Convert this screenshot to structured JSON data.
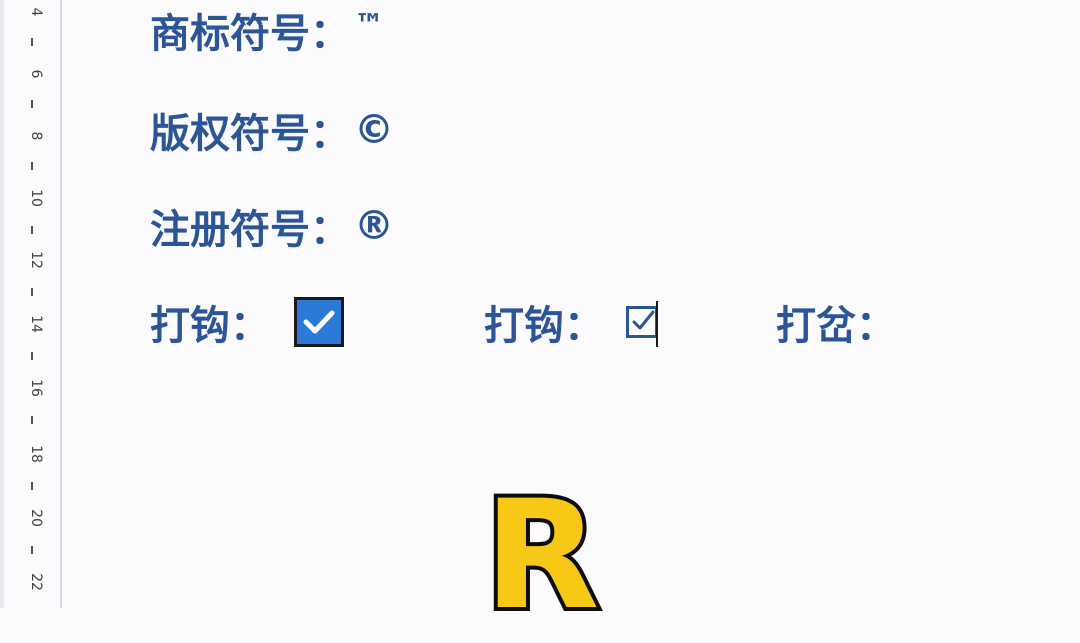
{
  "ruler": {
    "labels": [
      "4",
      "6",
      "8",
      "10",
      "12",
      "14",
      "16",
      "18",
      "20",
      "22"
    ]
  },
  "lines": {
    "trademark": {
      "label": "商标符号：",
      "symbol": "™"
    },
    "copyright": {
      "label": "版权符号：",
      "symbol": "©"
    },
    "registered": {
      "label": "注册符号：",
      "symbol": "®"
    }
  },
  "checks": {
    "check1_label": "打钩：",
    "check2_label": "打钩：",
    "cross_label": "打岔："
  },
  "overlay": {
    "big_letter": "R"
  },
  "colors": {
    "text": "#2c5597",
    "checkbox_fill": "#2d7ad6",
    "overlay_fill": "#f7c816",
    "overlay_outline": "#0d0d0d"
  },
  "icons": {
    "filled_checkbox": "check-icon",
    "outline_checkbox": "ballot-box-check-icon"
  }
}
